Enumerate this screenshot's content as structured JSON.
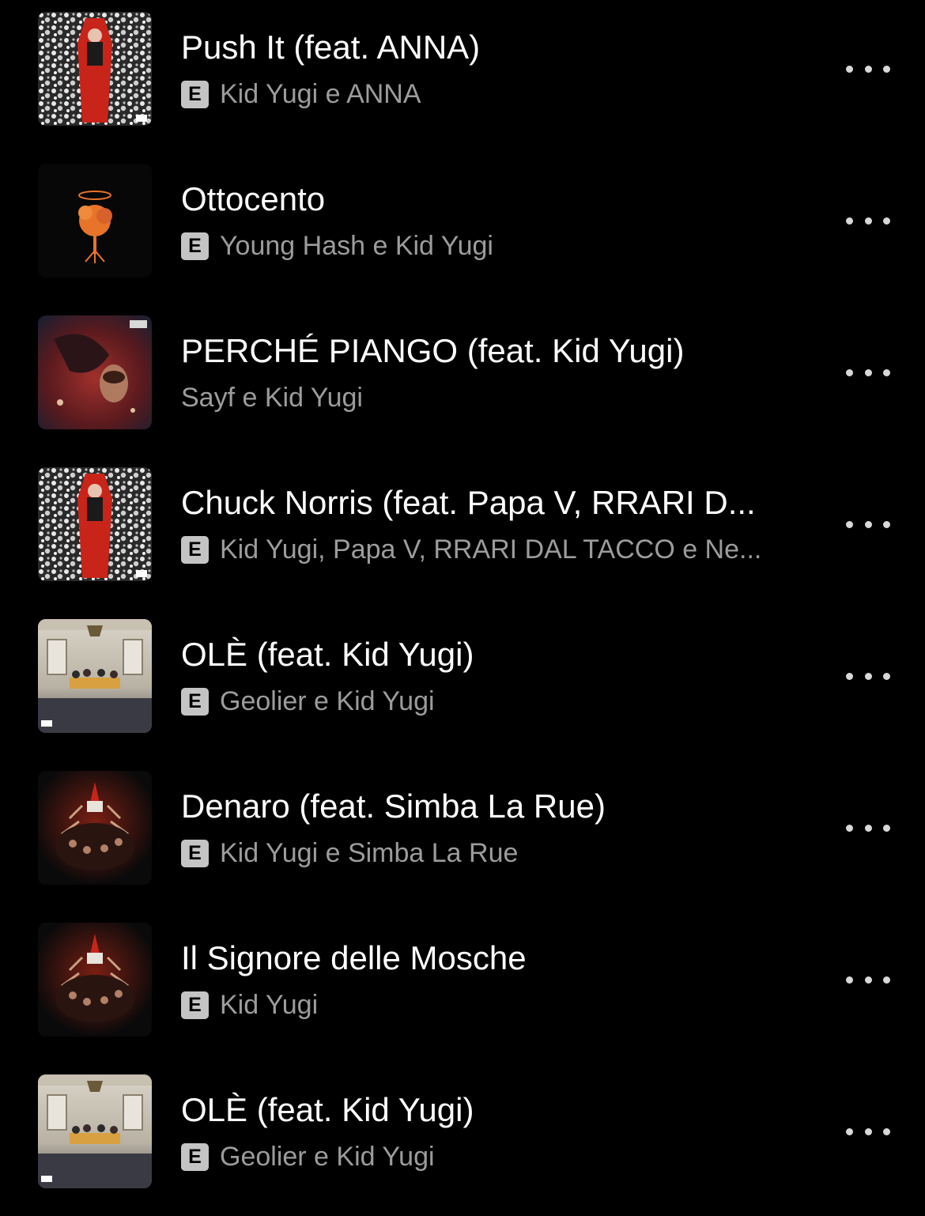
{
  "tracks": [
    {
      "title": "Push It (feat. ANNA)",
      "artists": "Kid Yugi e ANNA",
      "explicit": "E",
      "artwork": "coffin-cover"
    },
    {
      "title": "Ottocento",
      "artists": "Young Hash e Kid Yugi",
      "explicit": "E",
      "artwork": "orange-tree-cover"
    },
    {
      "title": "PERCHÉ PIANGO (feat. Kid Yugi)",
      "artists": "Sayf e Kid Yugi",
      "explicit": "",
      "artwork": "red-water-cover"
    },
    {
      "title": "Chuck Norris (feat. Papa V, RRARI D...",
      "artists": "Kid Yugi, Papa V, RRARI DAL TACCO e Ne...",
      "explicit": "E",
      "artwork": "coffin-cover"
    },
    {
      "title": "OLÈ (feat. Kid Yugi)",
      "artists": "Geolier e Kid Yugi",
      "explicit": "E",
      "artwork": "dining-room-cover"
    },
    {
      "title": "Denaro (feat. Simba La Rue)",
      "artists": "Kid Yugi e Simba La Rue",
      "explicit": "E",
      "artwork": "crowd-hands-cover"
    },
    {
      "title": "Il Signore delle Mosche",
      "artists": "Kid Yugi",
      "explicit": "E",
      "artwork": "crowd-hands-cover"
    },
    {
      "title": "OLÈ (feat. Kid Yugi)",
      "artists": "Geolier e Kid Yugi",
      "explicit": "E",
      "artwork": "dining-room-cover"
    }
  ],
  "icons": {
    "more": "more-options-icon",
    "explicit": "explicit-badge"
  },
  "colors": {
    "background": "#000000",
    "title": "#ffffff",
    "subtitle": "#9c9c9c",
    "badge": "#c4c4c4"
  }
}
